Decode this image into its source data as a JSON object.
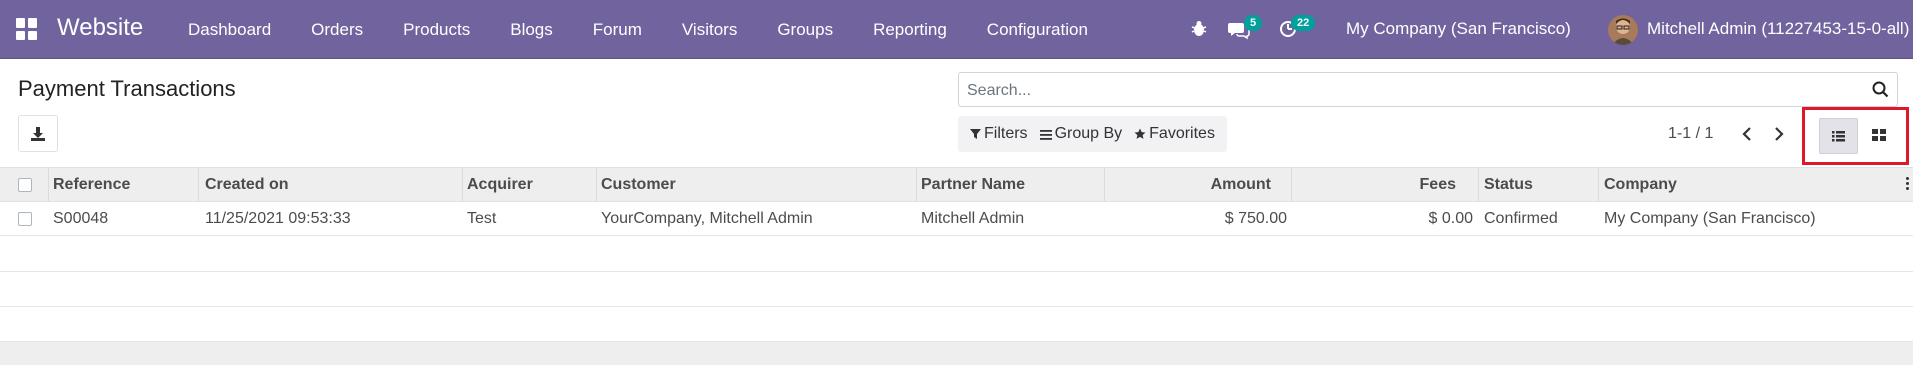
{
  "navbar": {
    "brand": "Website",
    "menu": [
      "Dashboard",
      "Orders",
      "Products",
      "Blogs",
      "Forum",
      "Visitors",
      "Groups",
      "Reporting",
      "Configuration"
    ],
    "messages_badge": "5",
    "activities_badge": "22",
    "company": "My Company (San Francisco)",
    "user": "Mitchell Admin (11227453-15-0-all)"
  },
  "control_panel": {
    "title": "Payment Transactions",
    "search_placeholder": "Search...",
    "filters_label": "Filters",
    "group_by_label": "Group By",
    "favorites_label": "Favorites",
    "pager": "1-1 / 1"
  },
  "table": {
    "columns": [
      "Reference",
      "Created on",
      "Acquirer",
      "Customer",
      "Partner Name",
      "Amount",
      "Fees",
      "Status",
      "Company"
    ],
    "rows": [
      {
        "reference": "S00048",
        "created_on": "11/25/2021 09:53:33",
        "acquirer": "Test",
        "customer": "YourCompany, Mitchell Admin",
        "partner_name": "Mitchell Admin",
        "amount": "$ 750.00",
        "fees": "$ 0.00",
        "status": "Confirmed",
        "company": "My Company (San Francisco)"
      }
    ]
  },
  "colors": {
    "navbar": "#71639e",
    "badge": "#00a09d",
    "highlight_box": "#e0162b"
  }
}
